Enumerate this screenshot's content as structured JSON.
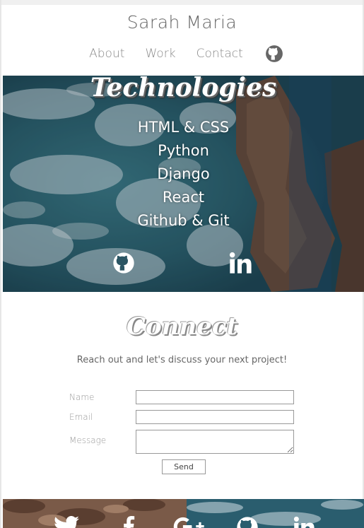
{
  "header": {
    "brand": "Sarah Maria",
    "nav": [
      "About",
      "Work",
      "Contact"
    ]
  },
  "technologies": {
    "title": "Technologies",
    "items": [
      "HTML & CSS",
      "Python",
      "Django",
      "React",
      "Github & Git"
    ]
  },
  "connect": {
    "title": "Connect",
    "subtitle": "Reach out and let's discuss your next project!",
    "fields": {
      "name": "Name",
      "email": "Email",
      "message": "Message"
    },
    "send_label": "Send"
  },
  "icons": {
    "nav": "github-icon",
    "hero": [
      "github-icon",
      "linkedin-icon"
    ],
    "footer": [
      "twitter-icon",
      "facebook-icon",
      "googleplus-icon",
      "github-icon",
      "linkedin-icon"
    ]
  },
  "colors": {
    "hero_overlay": "#1c4a5a",
    "rocks": "#6b4a38",
    "text_muted": "#888888"
  }
}
